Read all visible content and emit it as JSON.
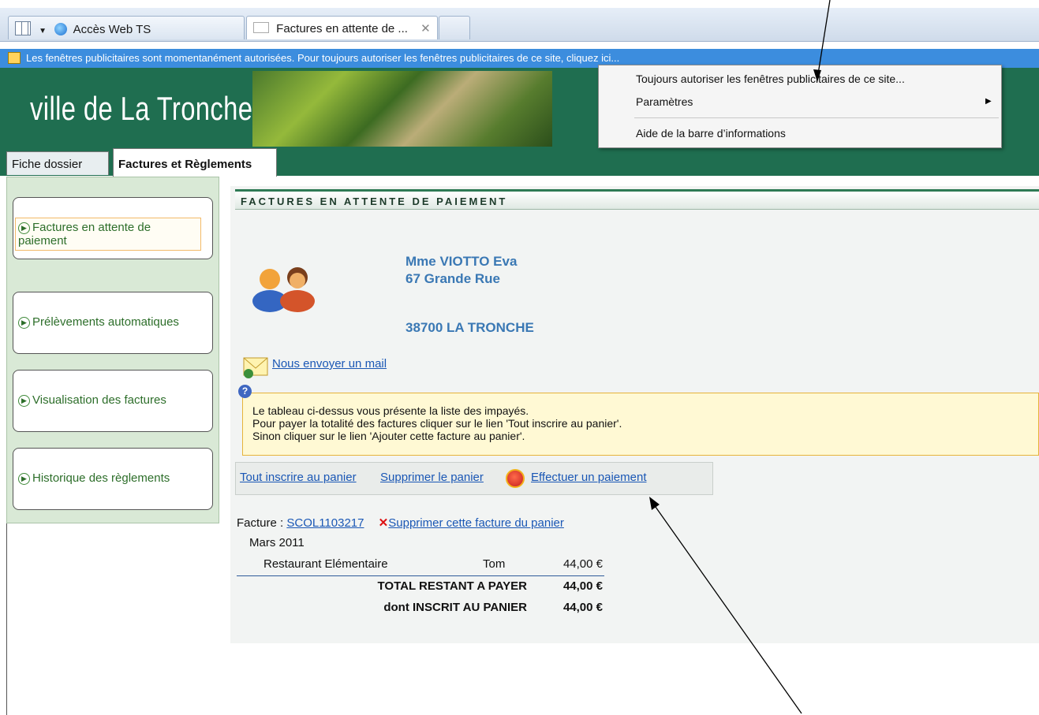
{
  "browser": {
    "tabs": [
      {
        "label": "Accès Web TS"
      },
      {
        "label": "Factures en attente de ..."
      }
    ],
    "infobar_text": "Les fenêtres publicitaires sont momentanément autorisées. Pour toujours autoriser les fenêtres publicitaires de ce site, cliquez ici..."
  },
  "context_menu": {
    "items": [
      {
        "label": "Toujours autoriser les fenêtres publicitaires de ce site..."
      },
      {
        "label": "Paramètres"
      },
      {
        "label": "Aide de la barre d’informations"
      }
    ]
  },
  "site": {
    "title": "ville de La Tronche",
    "tabs": [
      {
        "label": "Fiche dossier"
      },
      {
        "label": "Factures et Règlements"
      }
    ]
  },
  "sidebar": {
    "items": [
      {
        "label": "Factures en attente de paiement"
      },
      {
        "label": "Prélèvements automatiques"
      },
      {
        "label": "Visualisation des factures"
      },
      {
        "label": "Historique des règlements"
      }
    ]
  },
  "main": {
    "section_title": "FACTURES EN ATTENTE DE PAIEMENT",
    "address": {
      "name": "Mme VIOTTO Eva",
      "street": "67 Grande Rue",
      "city": "38700 LA TRONCHE"
    },
    "mail_link": "Nous envoyer un mail",
    "help_lines": [
      "Le tableau ci-dessus vous présente la liste des impayés.",
      "Pour payer la totalité des factures cliquer sur le lien 'Tout inscrire au panier'.",
      "Sinon cliquer sur le lien 'Ajouter cette facture au panier'."
    ],
    "actions": {
      "add_all": "Tout inscrire au panier",
      "clear_cart": "Supprimer le panier",
      "pay": "Effectuer un paiement"
    },
    "invoice": {
      "label": "Facture : ",
      "number": "SCOL1103217",
      "remove_link": "Supprimer cette facture du panier",
      "period": "Mars 2011",
      "line": {
        "service": "Restaurant Elémentaire",
        "child": "Tom",
        "amount": "44,00 €"
      },
      "total_label": "TOTAL RESTANT A PAYER",
      "total_amount": "44,00 €",
      "cart_label": "dont INSCRIT AU PANIER",
      "cart_amount": "44,00 €"
    }
  }
}
